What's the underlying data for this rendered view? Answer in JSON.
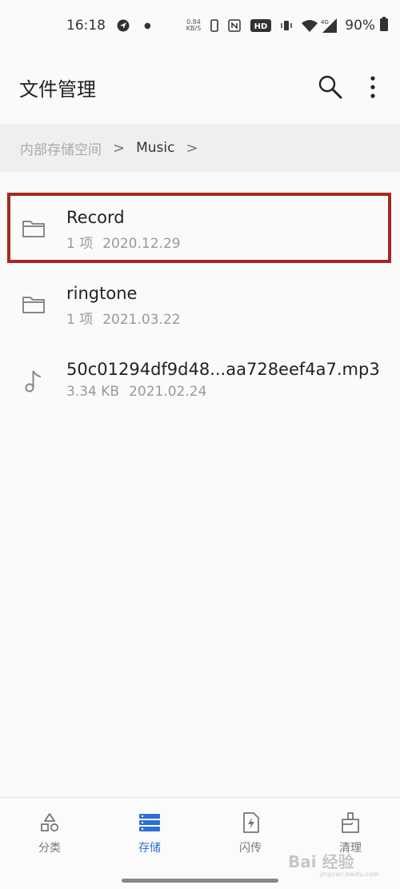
{
  "status_bar": {
    "time": "16:18",
    "net_speed_value": "0.84",
    "net_speed_unit": "KB/S",
    "hd_label": "HD",
    "signal_label": "4G",
    "battery_percent": "90%",
    "icons": [
      "location-arrow-icon",
      "phone-icon",
      "nfc-icon",
      "hd-icon",
      "vibrate-icon",
      "wifi-icon",
      "signal-icon",
      "battery-icon"
    ]
  },
  "app_bar": {
    "title": "文件管理",
    "icons": [
      "search-icon",
      "more-vert-icon"
    ]
  },
  "breadcrumb": {
    "root": "内部存储空间",
    "separator": ">",
    "current": "Music"
  },
  "files": [
    {
      "name": "Record",
      "count": "1 项",
      "date": "2020.12.29",
      "icon": "folder-icon",
      "highlighted": true
    },
    {
      "name": "ringtone",
      "count": "1 项",
      "date": "2021.03.22",
      "icon": "folder-icon"
    },
    {
      "name": "50c01294df9d48...aa728eef4a7.mp3",
      "size": "3.34 KB",
      "date": "2021.02.24",
      "icon": "music-note-icon"
    }
  ],
  "bottom_nav": {
    "items": [
      {
        "label": "分类",
        "icon": "category-icon"
      },
      {
        "label": "存储",
        "icon": "storage-icon",
        "active": true
      },
      {
        "label": "闪传",
        "icon": "flash-transfer-icon"
      },
      {
        "label": "清理",
        "icon": "clean-icon"
      }
    ]
  },
  "colors": {
    "accent": "#2d6fd6",
    "highlight_border": "#a8281f",
    "breadcrumb_bg": "#efefef",
    "background": "#fafafa"
  },
  "watermark": {
    "text": "Bai 经验",
    "sub": "jingyan.baidu.com"
  }
}
